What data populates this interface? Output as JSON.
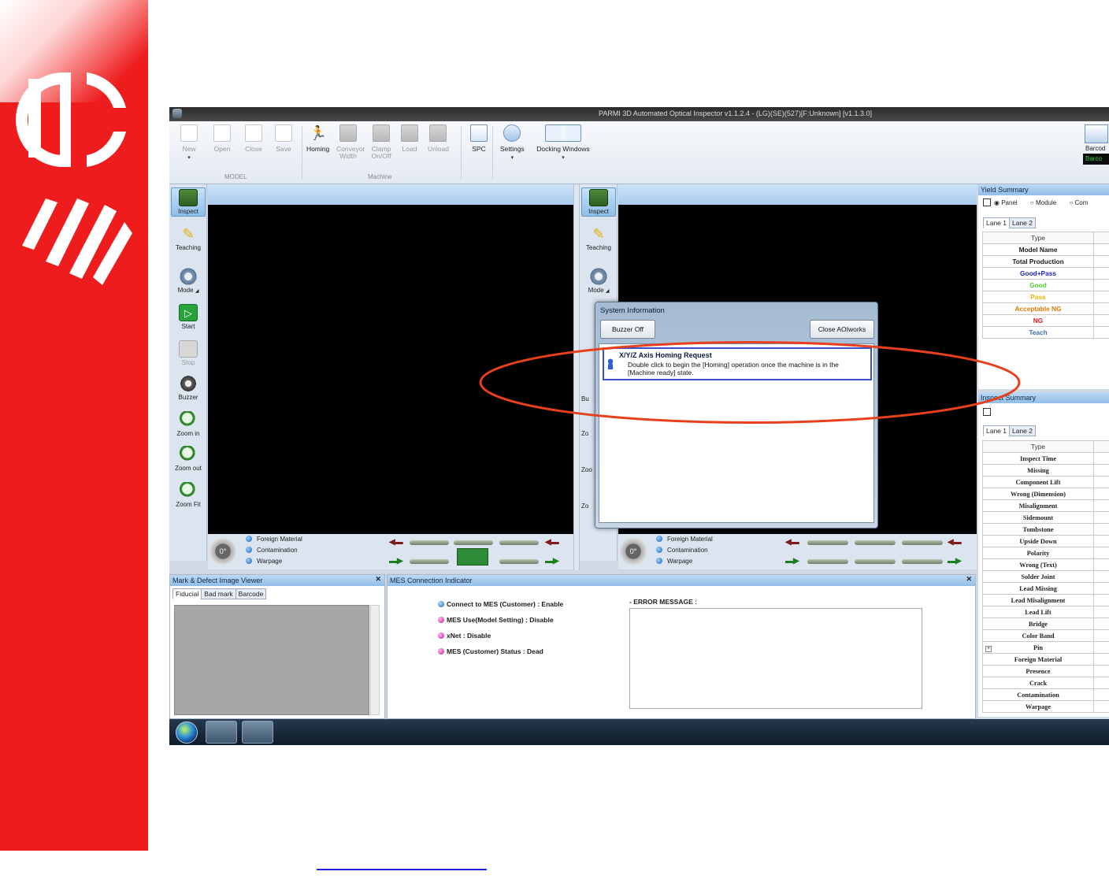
{
  "window": {
    "title": "PARMI 3D Automated Optical Inspector v1.1.2.4 - (LG)(SE)(527)[F:Unknown] [v1.1.3.0]"
  },
  "ribbon": {
    "model_items": [
      {
        "label": "New",
        "dropdown": "▾"
      },
      {
        "label": "Open"
      },
      {
        "label": "Close"
      },
      {
        "label": "Save"
      }
    ],
    "model_group": "MODEL",
    "machine_items": [
      {
        "label": "Homing"
      },
      {
        "label": "Conveyor Width"
      },
      {
        "label": "Clamp On/Off"
      },
      {
        "label": "Load"
      },
      {
        "label": "Unload"
      }
    ],
    "machine_group": "Machine",
    "spc_label": "SPC",
    "settings_label": "Settings",
    "docking_label": "Docking Windows",
    "dropdown_arrow": "▾",
    "barcode_label": "Barcod",
    "barcode_value": "Barco"
  },
  "toolbar_left": [
    {
      "label": "Inspect"
    },
    {
      "label": "Teaching"
    },
    {
      "label": "Mode"
    },
    {
      "label": "Start"
    },
    {
      "label": "Stop"
    },
    {
      "label": "Buzzer"
    },
    {
      "label": "Zoom in"
    },
    {
      "label": "Zoom out"
    },
    {
      "label": "Zoom Fit"
    }
  ],
  "toolbar_right_partial": [
    {
      "label": "Inspect"
    },
    {
      "label": "Teaching"
    },
    {
      "label": "Mode"
    },
    {
      "label": "Bu"
    },
    {
      "label": "Zo"
    },
    {
      "label": "Zoo"
    },
    {
      "label": "Zo"
    }
  ],
  "mode_arrow": "◢",
  "status": {
    "dial": "0°",
    "foreign_material": "Foreign Material",
    "contamination": "Contamination",
    "warpage": "Warpage"
  },
  "viewer": {
    "title": "Mark & Defect Image Viewer",
    "tabs": [
      "Fiducial",
      "Bad mark",
      "Barcode"
    ],
    "close": "✕"
  },
  "mes": {
    "title": "MES Connection Indicator",
    "close": "✕",
    "items": [
      "Connect to MES (Customer) : Enable",
      "MES Use(Model Setting) : Disable",
      "xNet : Disable",
      "MES (Customer) Status : Dead"
    ],
    "error_label": "- ERROR MESSAGE :"
  },
  "yield": {
    "title": "Yield Summary",
    "options": [
      "Panel",
      "Module",
      "Com"
    ],
    "tabs": [
      "Lane 1",
      "Lane 2"
    ],
    "header": "Type",
    "rows": [
      {
        "label": "Model Name",
        "color": "#1a1a1a"
      },
      {
        "label": "Total Production",
        "color": "#1a1a1a"
      },
      {
        "label": "Good+Pass",
        "color": "#1f1fc9"
      },
      {
        "label": "Good",
        "color": "#4fce2f"
      },
      {
        "label": "Pass",
        "color": "#e8b400"
      },
      {
        "label": "Acceptable NG",
        "color": "#d87a00"
      },
      {
        "label": "NG",
        "color": "#e01818"
      },
      {
        "label": "Teach",
        "color": "#3a6fb0"
      }
    ]
  },
  "inspect_summary": {
    "title": "Inspect Summary",
    "tabs": [
      "Lane 1",
      "Lane 2"
    ],
    "header": "Type",
    "rows": [
      "Inspect Time",
      "Missing",
      "Component Lift",
      "Wrong (Dimension)",
      "Misalignment",
      "Sidemount",
      "Tombstone",
      "Upside Down",
      "Polarity",
      "Wrong (Text)",
      "Solder Joint",
      "Lead Missing",
      "Lead Misalignment",
      "Lead Lift",
      "Bridge",
      "Color Band",
      "Pin",
      "Foreign Material",
      "Presence",
      "Crack",
      "Contamination",
      "Warpage"
    ],
    "expand": "+"
  },
  "dialog": {
    "title": "System Information",
    "buzzer_off": "Buzzer Off",
    "close_btn": "Close AOIworks",
    "message_title": "X/Y/Z Axis Homing Request",
    "message_body": "Double click to begin the [Homing] operation once the machine is in the [Machine ready] state."
  },
  "colors": {
    "brand_red": "#ee1c1c",
    "annotation": "#e8401c",
    "message_border": "#3a52c8"
  }
}
